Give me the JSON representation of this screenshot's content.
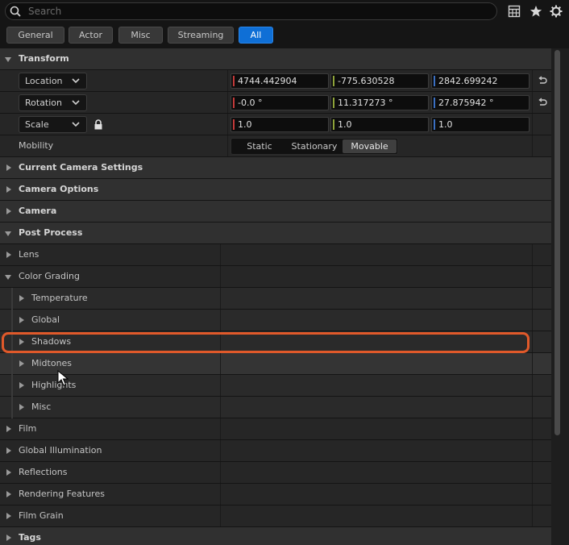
{
  "search": {
    "placeholder": "Search",
    "value": ""
  },
  "toolbar_icons": [
    "table-view-icon",
    "favorites-star-icon",
    "settings-gear-icon"
  ],
  "tabs": [
    "General",
    "Actor",
    "Misc",
    "Streaming",
    "All"
  ],
  "active_tab": "All",
  "transform": {
    "header": "Transform",
    "location": {
      "mode": "Location",
      "x": "4744.442904",
      "y": "-775.630528",
      "z": "2842.699242"
    },
    "rotation": {
      "mode": "Rotation",
      "x": "-0.0 °",
      "y": "11.317273 °",
      "z": "27.875942 °"
    },
    "scale": {
      "mode": "Scale",
      "x": "1.0",
      "y": "1.0",
      "z": "1.0"
    },
    "mobility": {
      "label": "Mobility",
      "options": [
        "Static",
        "Stationary",
        "Movable"
      ],
      "selected": "Movable"
    }
  },
  "categories": {
    "current_camera_settings": "Current Camera Settings",
    "camera_options": "Camera Options",
    "camera": "Camera",
    "post_process": "Post Process",
    "tags": "Tags"
  },
  "post_process": {
    "lens": "Lens",
    "color_grading": "Color Grading",
    "color_grading_children": [
      "Temperature",
      "Global",
      "Shadows",
      "Midtones",
      "Highlights",
      "Misc"
    ],
    "film": "Film",
    "global_illumination": "Global Illumination",
    "reflections": "Reflections",
    "rendering_features": "Rendering Features",
    "film_grain": "Film Grain"
  },
  "colors": {
    "accent": "#0f6fd6",
    "highlight": "#e0592a",
    "x_axis": "#c23a3a",
    "y_axis": "#8ea33a",
    "z_axis": "#3a6fc2"
  }
}
